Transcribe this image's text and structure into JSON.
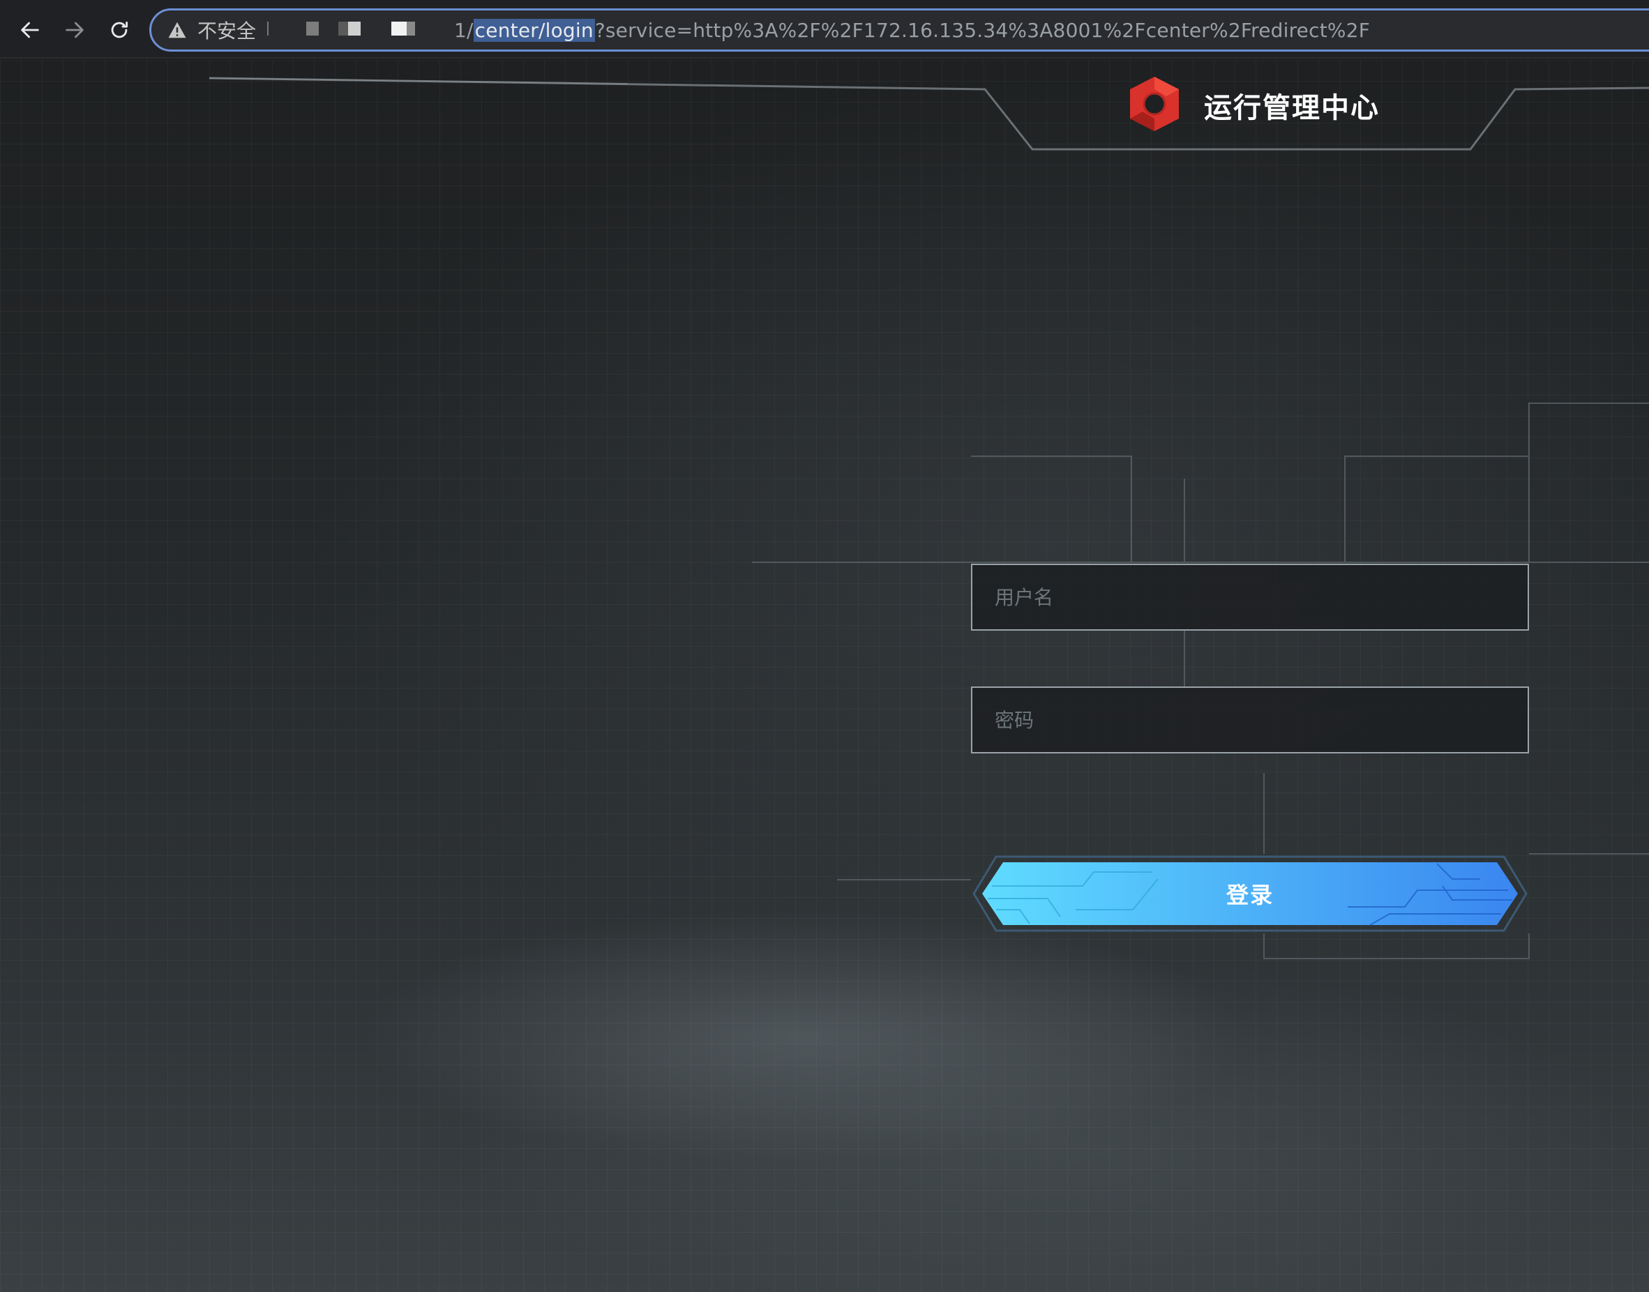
{
  "browser": {
    "security_label": "不安全",
    "url_host_tail": "1/",
    "url_path": "center/login",
    "url_query": "?service=http%3A%2F%2F172.16.135.34%3A8001%2Fcenter%2Fredirect%2F"
  },
  "header": {
    "title": "运行管理中心",
    "logo_color": "#d9312c"
  },
  "login_form": {
    "username_placeholder": "用户名",
    "username_value": "",
    "password_placeholder": "密码",
    "password_value": "",
    "submit_label": "登录",
    "button_color_start": "#5fdcff",
    "button_color_end": "#3a86f0"
  }
}
